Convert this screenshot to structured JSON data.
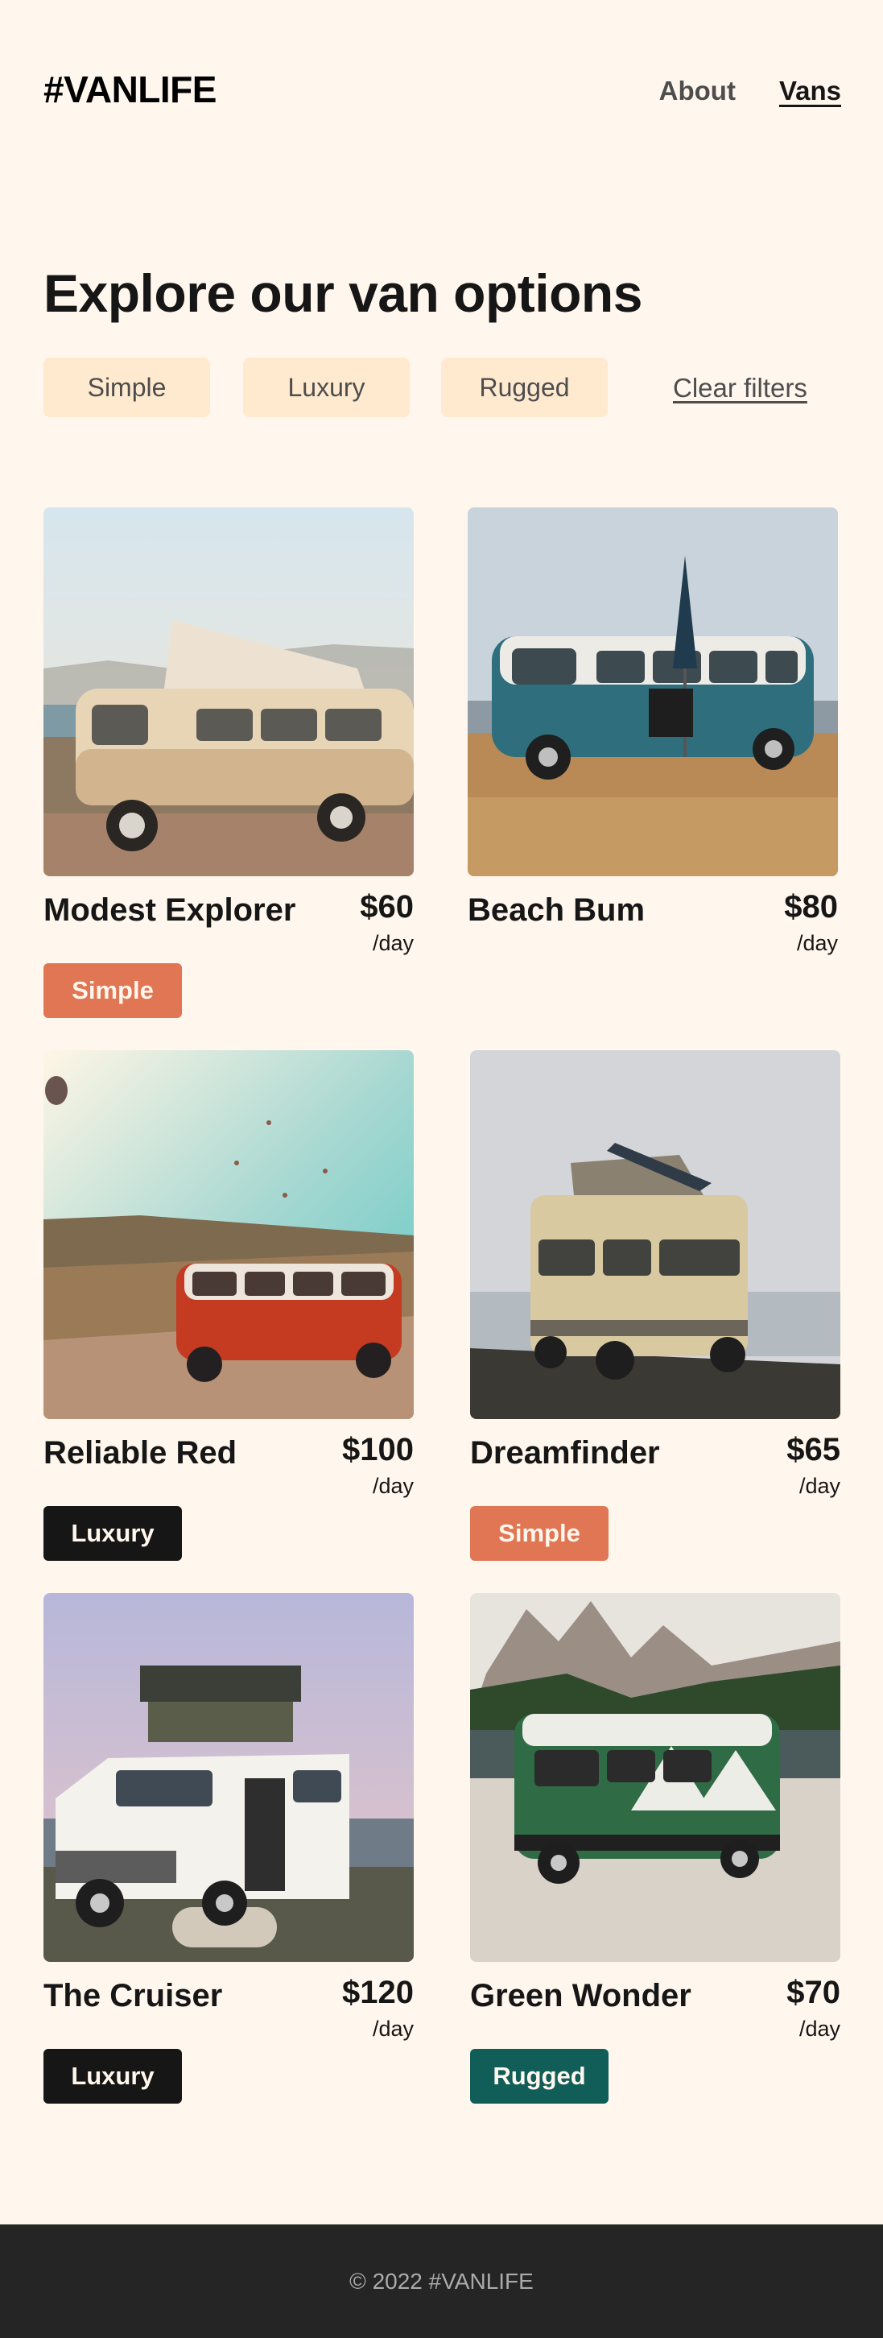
{
  "header": {
    "logo": "#VANLIFE",
    "nav": [
      {
        "label": "About",
        "active": false
      },
      {
        "label": "Vans",
        "active": true
      }
    ]
  },
  "page": {
    "title": "Explore our van options"
  },
  "filters": {
    "options": [
      "Simple",
      "Luxury",
      "Rugged"
    ],
    "clear_label": "Clear filters"
  },
  "vans": [
    {
      "name": "Modest Explorer",
      "price": "$60",
      "per": "/day",
      "type": "Simple"
    },
    {
      "name": "Beach Bum",
      "price": "$80",
      "per": "/day",
      "type": ""
    },
    {
      "name": "Reliable Red",
      "price": "$100",
      "per": "/day",
      "type": "Luxury"
    },
    {
      "name": "Dreamfinder",
      "price": "$65",
      "per": "/day",
      "type": "Simple"
    },
    {
      "name": "The Cruiser",
      "price": "$120",
      "per": "/day",
      "type": "Luxury"
    },
    {
      "name": "Green Wonder",
      "price": "$70",
      "per": "/day",
      "type": "Rugged"
    }
  ],
  "footer": {
    "text": "© 2022 #VANLIFE"
  },
  "colors": {
    "background": "#FFF7ED",
    "filter_bg": "#FFEAD0",
    "simple": "#E17654",
    "luxury": "#161616",
    "rugged": "#115E59",
    "footer_bg": "#252525"
  }
}
